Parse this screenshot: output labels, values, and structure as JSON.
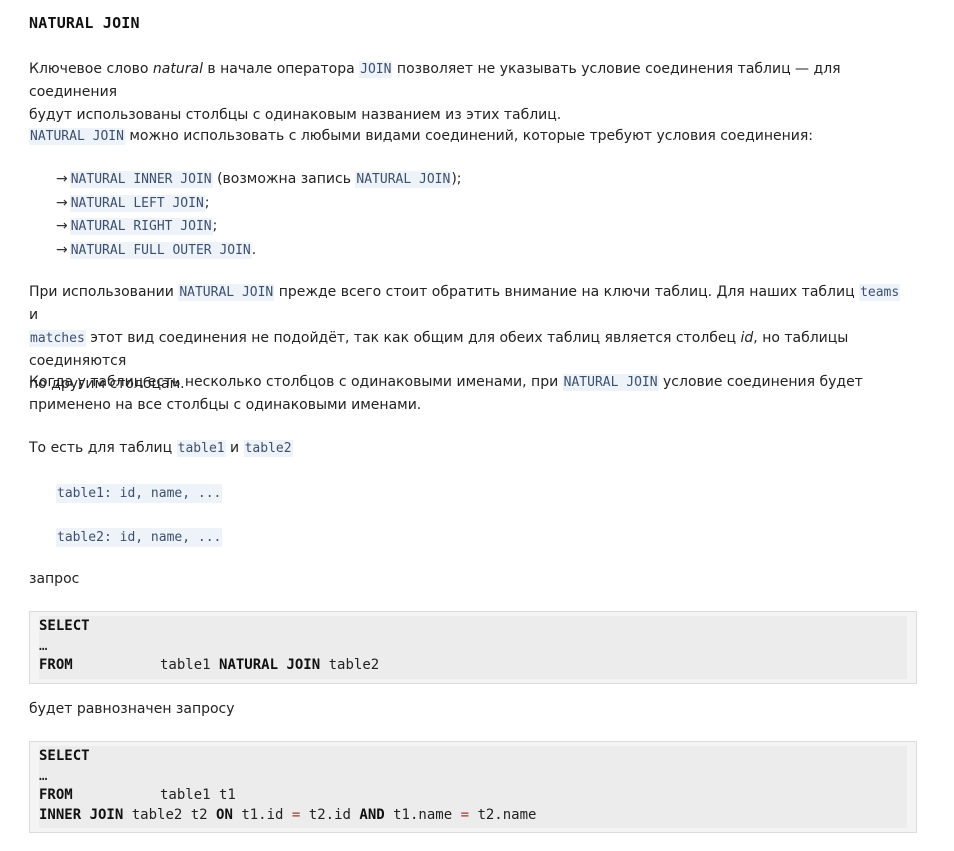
{
  "heading": "NATURAL JOIN",
  "p1": {
    "t1": "Ключевое слово ",
    "em": "natural",
    "t2": " в начале оператора ",
    "code": "JOIN",
    "t3": " позволяет не указывать условие соединения таблиц — для соединения",
    "t4": "будут использованы столбцы с одинаковым названием из этих таблиц."
  },
  "p2": {
    "code": "NATURAL JOIN",
    "text": " можно использовать с любыми видами соединений, которые требуют условия соединения:"
  },
  "list": [
    {
      "code": "NATURAL INNER JOIN",
      "text": " (возможна запись ",
      "code2": "NATURAL JOIN",
      "tail": ");"
    },
    {
      "code": "NATURAL LEFT JOIN",
      "text": ";"
    },
    {
      "code": "NATURAL RIGHT JOIN",
      "text": ";"
    },
    {
      "code": "NATURAL FULL OUTER JOIN",
      "text": "."
    }
  ],
  "arrow": "→",
  "p3": {
    "t1": "При использовании ",
    "code1": "NATURAL JOIN",
    "t2": " прежде всего стоит обратить внимание на ключи таблиц. Для наших таблиц ",
    "code2": "teams",
    "t3": " и",
    "code3": "matches",
    "t4": " этот вид соединения не подойдёт, так как общим для обеих таблиц является столбец ",
    "em": "id",
    "t5": ", но таблицы соединяются",
    "t6": "по другим столбцам."
  },
  "p4": {
    "t1": "Когда у таблиц есть несколько столбцов с одинаковыми именами, при ",
    "code": "NATURAL JOIN",
    "t2": " условие соединения будет",
    "t3": "применено на все столбцы с одинаковыми именами."
  },
  "p5": {
    "t1": "То есть для таблиц ",
    "code1": "table1",
    "t2": " и ",
    "code2": "table2"
  },
  "schema1": "table1: id, name, ...",
  "schema2": "table2: id, name, ...",
  "label_query": "запрос",
  "query1": {
    "select": "SELECT",
    "ellipsis": "…",
    "from": "FROM",
    "t1": "table1",
    "nj": "NATURAL JOIN",
    "t2": "table2"
  },
  "label_equiv": "будет равнозначен запросу",
  "query2": {
    "select": "SELECT",
    "ellipsis": "…",
    "from": "FROM",
    "from_rest": "table1 t1",
    "inner_join": "INNER JOIN",
    "join_table": "table2 t2",
    "on": "ON",
    "c1": "t1.id",
    "eq": "=",
    "c2": "t2.id",
    "and": "AND",
    "c3": "t1.name",
    "c4": "t2.name"
  }
}
